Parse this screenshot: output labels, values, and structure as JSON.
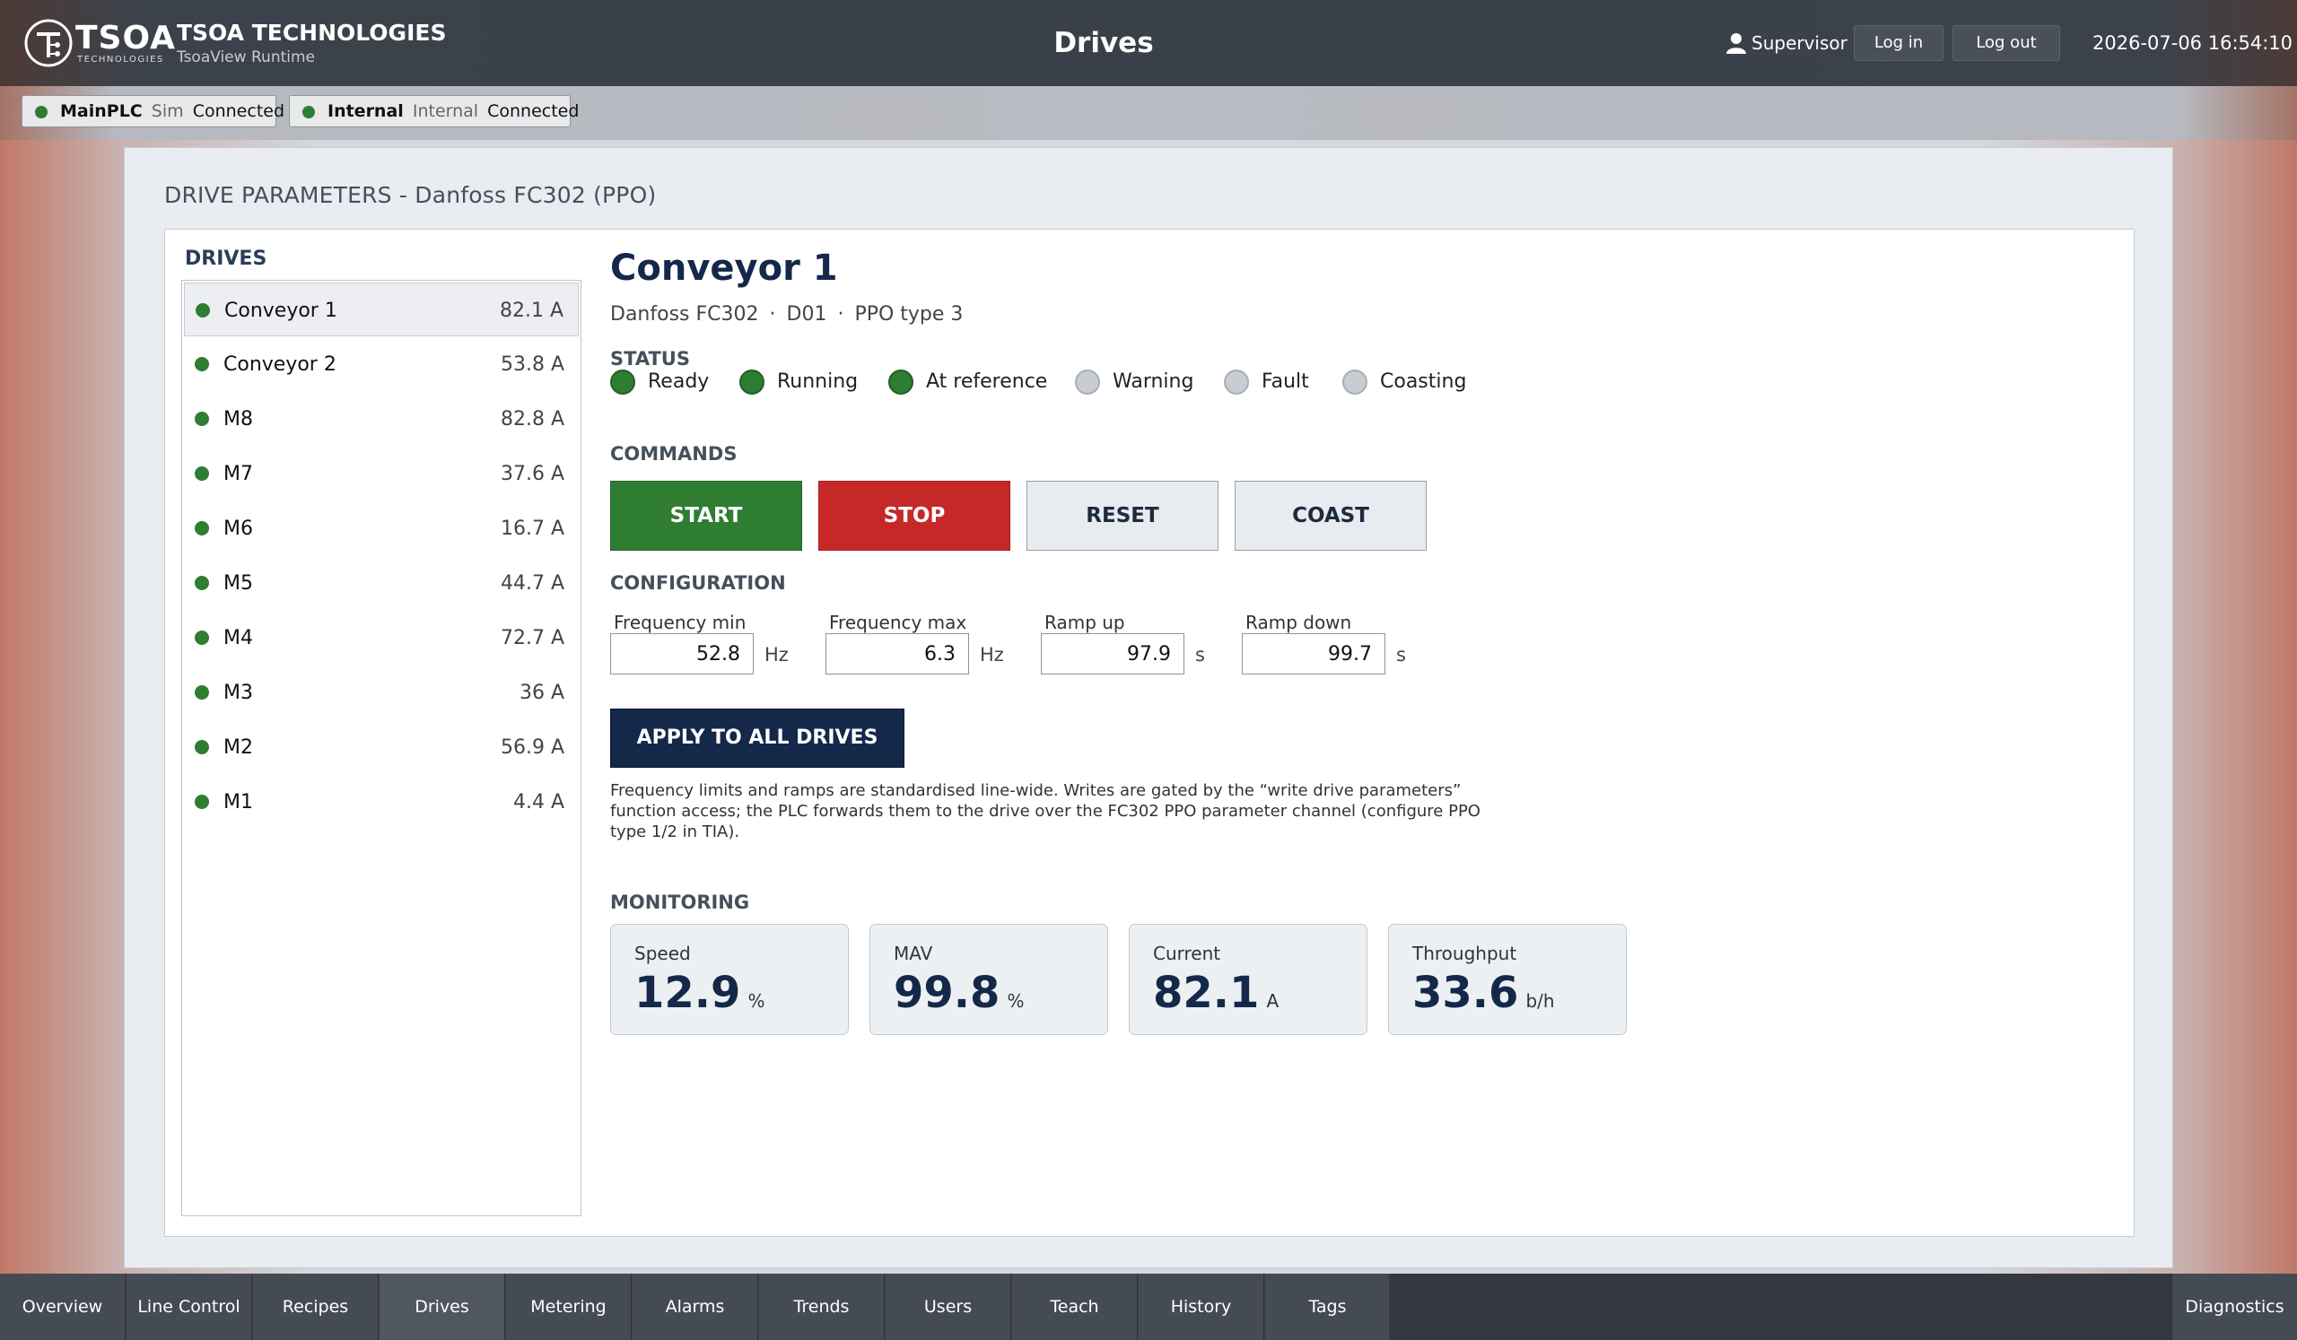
{
  "header": {
    "logo_word": "TSOA",
    "logo_sub": "TECHNOLOGIES",
    "company": "TSOA TECHNOLOGIES",
    "app_name": "TsoaView Runtime",
    "page_title": "Drives",
    "user": "Supervisor",
    "login_label": "Log in",
    "logout_label": "Log out",
    "datetime": "2026-07-06  16:54:10"
  },
  "connections": [
    {
      "name": "MainPLC",
      "type": "Sim",
      "status": "Connected",
      "color": "#2e7d32"
    },
    {
      "name": "Internal",
      "type": "Internal",
      "status": "Connected",
      "color": "#2e7d32"
    }
  ],
  "panel": {
    "title": "DRIVE PARAMETERS  -  Danfoss FC302 (PPO)",
    "drives_label": "DRIVES"
  },
  "drives": [
    {
      "name": "Conveyor 1",
      "current": "82.1 A"
    },
    {
      "name": "Conveyor 2",
      "current": "53.8 A"
    },
    {
      "name": "M8",
      "current": "82.8 A"
    },
    {
      "name": "M7",
      "current": "37.6 A"
    },
    {
      "name": "M6",
      "current": "16.7 A"
    },
    {
      "name": "M5",
      "current": "44.7 A"
    },
    {
      "name": "M4",
      "current": "72.7 A"
    },
    {
      "name": "M3",
      "current": "36 A"
    },
    {
      "name": "M2",
      "current": "56.9 A"
    },
    {
      "name": "M1",
      "current": "4.4 A"
    }
  ],
  "detail": {
    "title": "Conveyor 1",
    "model": "Danfoss FC302",
    "sep": "·",
    "id": "D01",
    "ppo": "PPO type 3",
    "status_label": "STATUS",
    "status": [
      {
        "label": "Ready",
        "on": true
      },
      {
        "label": "Running",
        "on": true
      },
      {
        "label": "At reference",
        "on": true
      },
      {
        "label": "Warning",
        "on": false
      },
      {
        "label": "Fault",
        "on": false
      },
      {
        "label": "Coasting",
        "on": false
      }
    ],
    "commands_label": "COMMANDS",
    "commands": {
      "start": "START",
      "stop": "STOP",
      "reset": "RESET",
      "coast": "COAST"
    },
    "config_label": "CONFIGURATION",
    "config": [
      {
        "label": "Frequency min",
        "value": "52.8",
        "unit": "Hz"
      },
      {
        "label": "Frequency max",
        "value": "6.3",
        "unit": "Hz"
      },
      {
        "label": "Ramp up",
        "value": "97.9",
        "unit": "s"
      },
      {
        "label": "Ramp down",
        "value": "99.7",
        "unit": "s"
      }
    ],
    "apply_label": "APPLY TO ALL DRIVES",
    "note": "Frequency limits and ramps are standardised line-wide. Writes are gated by the “write drive parameters” function access; the PLC forwards them to the drive over the FC302 PPO parameter channel (configure PPO type 1/2 in TIA).",
    "monitoring_label": "MONITORING",
    "monitoring": [
      {
        "label": "Speed",
        "value": "12.9",
        "unit": "%"
      },
      {
        "label": "MAV",
        "value": "99.8",
        "unit": "%"
      },
      {
        "label": "Current",
        "value": "82.1",
        "unit": "A"
      },
      {
        "label": "Throughput",
        "value": "33.6",
        "unit": "b/h"
      }
    ]
  },
  "nav": {
    "tabs": [
      "Overview",
      "Line Control",
      "Recipes",
      "Drives",
      "Metering",
      "Alarms",
      "Trends",
      "Users",
      "Teach",
      "History",
      "Tags"
    ],
    "active": "Drives",
    "diagnostics": "Diagnostics"
  },
  "colors": {
    "ok": "#2e7d32",
    "off": "#c8ccd3",
    "start": "#2e7d32",
    "stop": "#c62828",
    "apply": "#14284a"
  }
}
